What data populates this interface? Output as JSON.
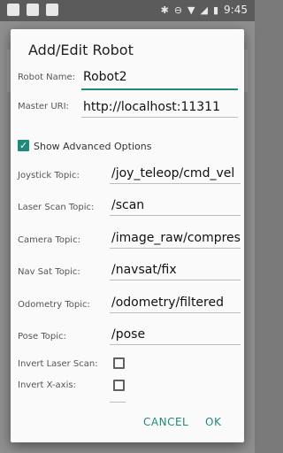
{
  "status_bar": {
    "time": "9:45",
    "left_icons": [
      "image-icon",
      "square-icon",
      "cat-icon"
    ],
    "right_icons": [
      "bluetooth-icon",
      "minus-circle-icon",
      "wifi-icon",
      "signal-icon",
      "battery-icon"
    ]
  },
  "dialog": {
    "title": "Add/Edit Robot",
    "robot_name_label": "Robot Name:",
    "robot_name_value": "Robot2",
    "master_uri_label": "Master URI:",
    "master_uri_value": "http://localhost:11311",
    "advanced_label": "Show Advanced Options",
    "advanced_checked": true,
    "fields": [
      {
        "label": "Joystick Topic:",
        "value": "/joy_teleop/cmd_vel"
      },
      {
        "label": "Laser Scan Topic:",
        "value": "/scan"
      },
      {
        "label": "Camera Topic:",
        "value": "/image_raw/compresse"
      },
      {
        "label": "Nav Sat Topic:",
        "value": "/navsat/fix"
      },
      {
        "label": "Odometry Topic:",
        "value": "/odometry/filtered"
      },
      {
        "label": "Pose Topic:",
        "value": "/pose"
      }
    ],
    "invert_laser_label": "Invert Laser Scan:",
    "invert_laser_checked": false,
    "invert_x_label": "Invert X-axis:",
    "invert_x_checked": false,
    "cancel_label": "CANCEL",
    "ok_label": "OK"
  },
  "colors": {
    "accent": "#1f8a7a"
  }
}
